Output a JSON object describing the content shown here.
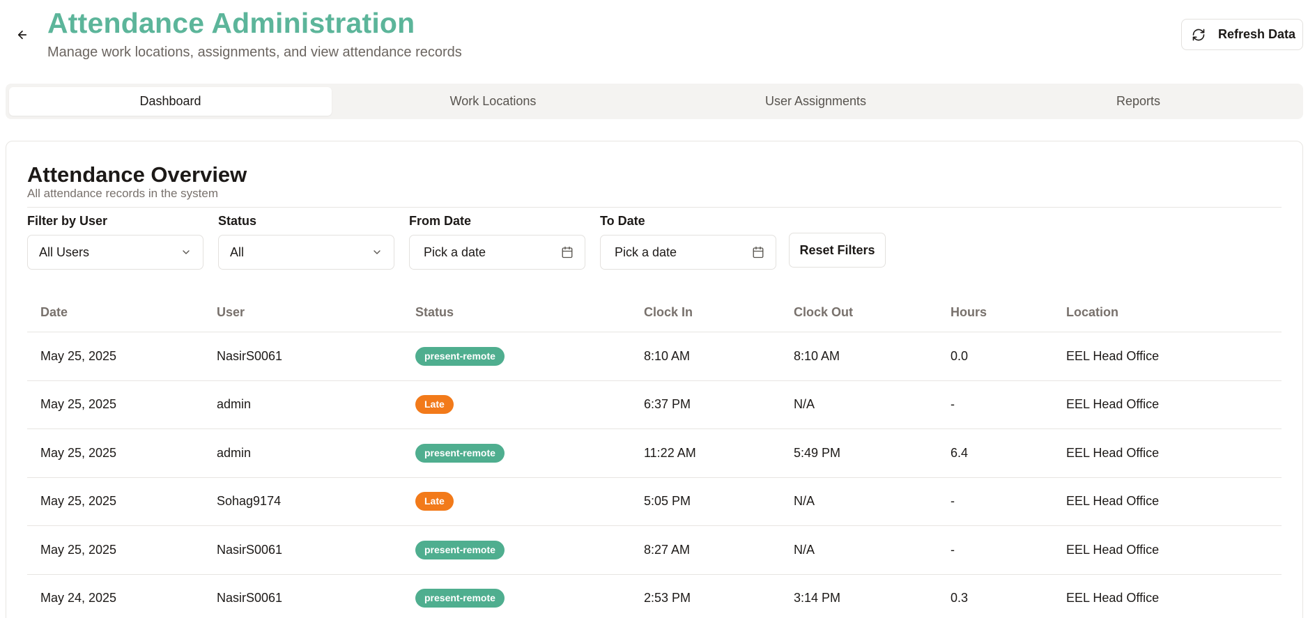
{
  "header": {
    "title": "Attendance Administration",
    "subtitle": "Manage work locations, assignments, and view attendance records",
    "refresh_label": "Refresh Data"
  },
  "tabs": [
    {
      "label": "Dashboard",
      "active": true
    },
    {
      "label": "Work Locations",
      "active": false
    },
    {
      "label": "User Assignments",
      "active": false
    },
    {
      "label": "Reports",
      "active": false
    }
  ],
  "overview": {
    "title": "Attendance Overview",
    "description": "All attendance records in the system"
  },
  "filters": {
    "user": {
      "label": "Filter by User",
      "value": "All Users"
    },
    "status": {
      "label": "Status",
      "value": "All"
    },
    "from_date": {
      "label": "From Date",
      "placeholder": "Pick a date"
    },
    "to_date": {
      "label": "To Date",
      "placeholder": "Pick a date"
    },
    "reset_label": "Reset Filters"
  },
  "table": {
    "columns": [
      "Date",
      "User",
      "Status",
      "Clock In",
      "Clock Out",
      "Hours",
      "Location"
    ],
    "rows": [
      {
        "date": "May 25, 2025",
        "user": "NasirS0061",
        "status": "present-remote",
        "clock_in": "8:10 AM",
        "clock_out": "8:10 AM",
        "hours": "0.0",
        "location": "EEL Head Office"
      },
      {
        "date": "May 25, 2025",
        "user": "admin",
        "status": "Late",
        "clock_in": "6:37 PM",
        "clock_out": "N/A",
        "hours": "-",
        "location": "EEL Head Office"
      },
      {
        "date": "May 25, 2025",
        "user": "admin",
        "status": "present-remote",
        "clock_in": "11:22 AM",
        "clock_out": "5:49 PM",
        "hours": "6.4",
        "location": "EEL Head Office"
      },
      {
        "date": "May 25, 2025",
        "user": "Sohag9174",
        "status": "Late",
        "clock_in": "5:05 PM",
        "clock_out": "N/A",
        "hours": "-",
        "location": "EEL Head Office"
      },
      {
        "date": "May 25, 2025",
        "user": "NasirS0061",
        "status": "present-remote",
        "clock_in": "8:27 AM",
        "clock_out": "N/A",
        "hours": "-",
        "location": "EEL Head Office"
      },
      {
        "date": "May 24, 2025",
        "user": "NasirS0061",
        "status": "present-remote",
        "clock_in": "2:53 PM",
        "clock_out": "3:14 PM",
        "hours": "0.3",
        "location": "EEL Head Office"
      }
    ]
  },
  "colors": {
    "accent": "#5cb59a",
    "status_present_remote": "#4fae8f",
    "status_late": "#f27a1a"
  },
  "icons": {
    "back": "arrow-left-icon",
    "refresh": "refresh-icon",
    "chevron": "chevron-down-icon",
    "calendar": "calendar-icon"
  }
}
